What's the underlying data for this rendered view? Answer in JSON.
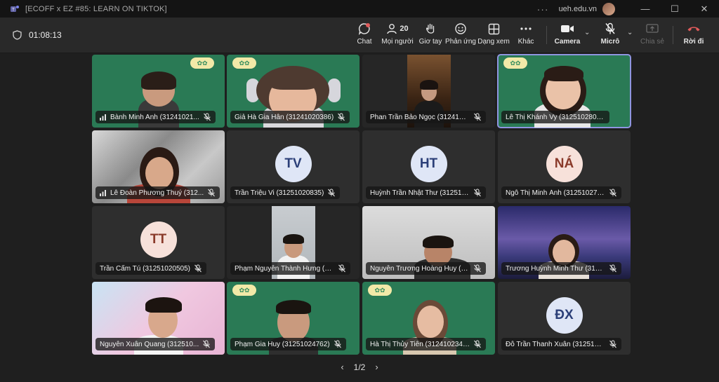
{
  "window": {
    "title": "[ECOFF x EZ #85: LEARN ON TIKTOK]",
    "org": "ueh.edu.vn",
    "more_glyph": "···",
    "min_glyph": "—",
    "max_glyph": "☐",
    "close_glyph": "✕"
  },
  "toolbar": {
    "timer": "01:08:13",
    "chat_label": "Chat",
    "people_label": "Mọi người",
    "people_count": "20",
    "raise_label": "Giơ tay",
    "react_label": "Phản ứng",
    "view_label": "Dạng xem",
    "more_label": "Khác",
    "camera_label": "Camera",
    "mic_label": "Micrô",
    "share_label": "Chia sẻ",
    "leave_label": "Rời đi",
    "caret_glyph": "⌄"
  },
  "participants": [
    {
      "name": "Bành Minh Anh (31241021...",
      "initials": "",
      "muted": true,
      "signal": true
    },
    {
      "name": "Giả Hà Gia Hân (31241020386)",
      "initials": "",
      "muted": true,
      "signal": false
    },
    {
      "name": "Phan Trần Bảo Ngọc (31241027...",
      "initials": "",
      "muted": true,
      "signal": false
    },
    {
      "name": "Lê Thị Khánh Vy (31251028019)",
      "initials": "",
      "muted": false,
      "signal": false
    },
    {
      "name": "Lê Đoàn Phương Thuý (312...",
      "initials": "",
      "muted": true,
      "signal": true
    },
    {
      "name": "Trần Triệu Vi (31251020835)",
      "initials": "TV",
      "muted": true,
      "signal": false
    },
    {
      "name": "Huỳnh Trần Nhật Thư (312510...",
      "initials": "HT",
      "muted": true,
      "signal": false
    },
    {
      "name": "Ngô Thị Minh Ánh (312510277...",
      "initials": "NÁ",
      "muted": true,
      "signal": false
    },
    {
      "name": "Trần Cẩm Tú (31251020505)",
      "initials": "TT",
      "muted": true,
      "signal": false
    },
    {
      "name": "Phạm Nguyễn Thành Hưng (312...",
      "initials": "",
      "muted": true,
      "signal": false
    },
    {
      "name": "Nguyễn Trương Hoàng Huy (31...",
      "initials": "",
      "muted": true,
      "signal": false
    },
    {
      "name": "Trương Huỳnh Minh Thư (3124...",
      "initials": "",
      "muted": true,
      "signal": false
    },
    {
      "name": "Nguyễn Xuân Quang (312510...",
      "initials": "",
      "muted": true,
      "signal": false
    },
    {
      "name": "Phạm Gia Huy (31251024762)",
      "initials": "",
      "muted": true,
      "signal": false
    },
    {
      "name": "Hà Thị Thủy Tiên (31241023429)",
      "initials": "",
      "muted": true,
      "signal": false
    },
    {
      "name": "Đỗ Trần Thanh Xuân (3125102...",
      "initials": "ĐX",
      "muted": true,
      "signal": false
    }
  ],
  "pager": {
    "label": "1/2",
    "prev_glyph": "‹",
    "next_glyph": "›"
  },
  "colors": {
    "accent": "#8f95e0",
    "leave": "#e05a5a",
    "tile_green": "#2a7a55"
  }
}
